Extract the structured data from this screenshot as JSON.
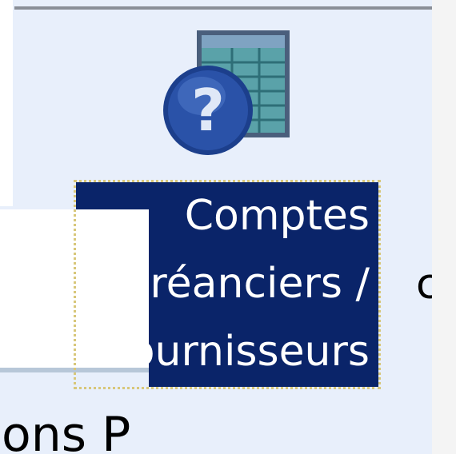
{
  "item": {
    "icon": "help-spreadsheet-icon",
    "label_lines": [
      "Comptes",
      "créanciers /",
      "fournisseurs"
    ]
  },
  "neighbor_label_fragment": "c",
  "bottom_label_fragment": "ons P",
  "colors": {
    "selection_bg": "#0a2469",
    "selection_text": "#ffffff",
    "focus_border": "#d8c77a",
    "canvas_bg": "#e8effb",
    "icon_blue": "#2a52a8",
    "icon_table": "#5aa2a9"
  }
}
